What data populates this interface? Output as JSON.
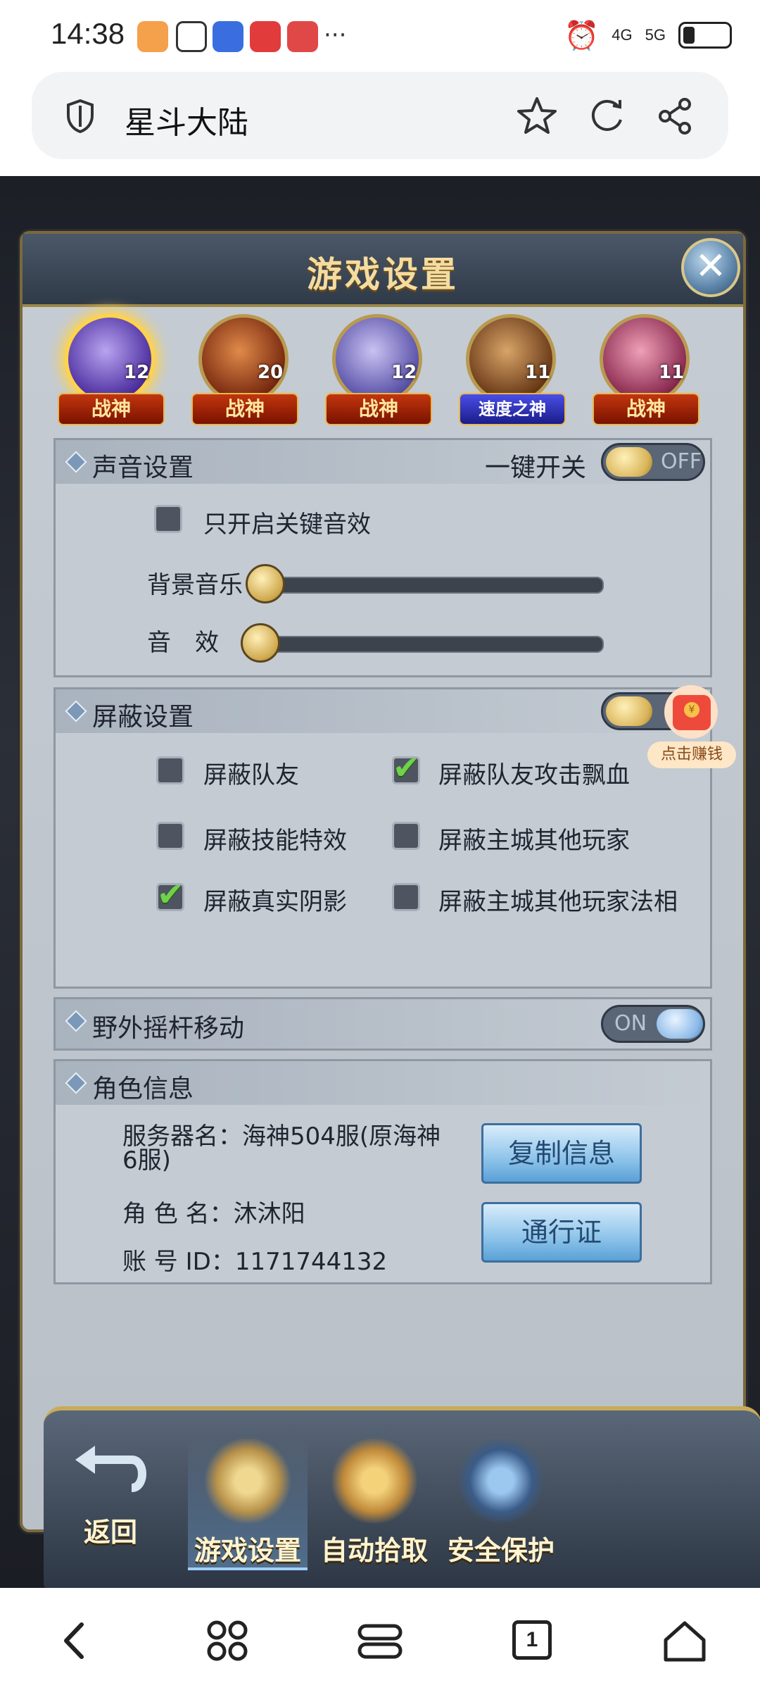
{
  "status_bar": {
    "time": "14:38",
    "network": [
      "4G",
      "5G"
    ],
    "more": "···"
  },
  "browser": {
    "page_title": "星斗大陆",
    "icons": [
      "shield-icon",
      "star-icon",
      "refresh-icon",
      "share-icon"
    ]
  },
  "game_settings": {
    "title": "游戏设置",
    "close": "✕",
    "heroes": [
      {
        "level": "12",
        "tag": "战神",
        "selected": true
      },
      {
        "level": "20",
        "tag": "战神"
      },
      {
        "level": "12",
        "tag": "战神"
      },
      {
        "level": "11",
        "tag": "速度之神"
      },
      {
        "level": "11",
        "tag": "战神"
      }
    ],
    "sound": {
      "title": "声音设置",
      "master_label": "一键开关",
      "master_toggle": "OFF",
      "key_sfx_only": "只开启关键音效",
      "bgm_label": "背景音乐",
      "sfx_label": "音　效",
      "bgm_level": 0,
      "sfx_level": 0
    },
    "shield": {
      "title": "屏蔽设置",
      "options": [
        {
          "label": "屏蔽队友",
          "checked": false
        },
        {
          "label": "屏蔽队友攻击飘血",
          "checked": true
        },
        {
          "label": "屏蔽技能特效",
          "checked": false
        },
        {
          "label": "屏蔽主城其他玩家",
          "checked": false
        },
        {
          "label": "屏蔽真实阴影",
          "checked": true
        },
        {
          "label": "屏蔽主城其他玩家法相",
          "checked": false
        }
      ]
    },
    "joystick": {
      "title": "野外摇杆移动",
      "toggle": "ON"
    },
    "role_info": {
      "title": "角色信息",
      "server_line1": "服务器名：海神504服(原海神",
      "server_line2": "6服)",
      "role_name": "角 色 名：沐沐阳",
      "account_id": "账 号 ID：1171744132",
      "copy_button": "复制信息",
      "pass_button": "通行证"
    },
    "nav": {
      "back": "返回",
      "items": [
        "游戏设置",
        "自动拾取",
        "安全保护"
      ]
    },
    "float_badge": {
      "label": "点击赚钱",
      "coin": "¥"
    }
  },
  "bottom_bar": {
    "tab_count": "1"
  }
}
